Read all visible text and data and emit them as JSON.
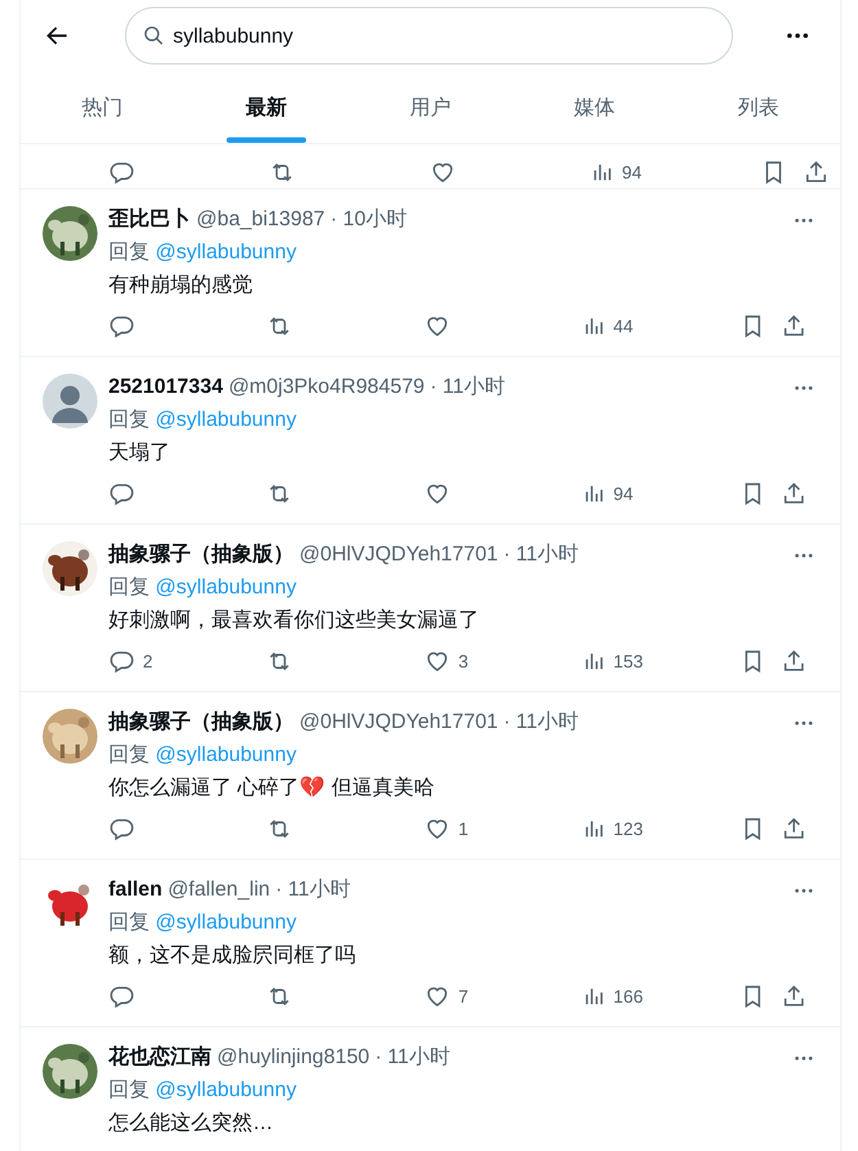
{
  "search": {
    "value": "syllabubunny"
  },
  "tabs": [
    {
      "label": "热门",
      "selected": false
    },
    {
      "label": "最新",
      "selected": true
    },
    {
      "label": "用户",
      "selected": false
    },
    {
      "label": "媒体",
      "selected": false
    },
    {
      "label": "列表",
      "selected": false
    }
  ],
  "partial_actions": {
    "views": "94"
  },
  "tweets": [
    {
      "name": "歪比巴卜",
      "handle": "@ba_bi13987",
      "time": "· 10小时",
      "reply_label": "回复",
      "reply_to": "@syllabubunny",
      "text": "有种崩塌的感觉",
      "actions": {
        "views": "44"
      }
    },
    {
      "avatar": {
        "kind": "default"
      },
      "name": "2521017334",
      "handle": "@m0j3Pko4R984579",
      "time": "· 11小时",
      "reply_label": "回复",
      "reply_to": "@syllabubunny",
      "text": "天塌了",
      "actions": {
        "views": "94"
      }
    },
    {
      "name": "抽象骡子（抽象版）",
      "handle": "@0HlVJQDYeh17701",
      "time": "· 11小时",
      "reply_label": "回复",
      "reply_to": "@syllabubunny",
      "text": "好刺激啊，最喜欢看你们这些美女漏逼了",
      "actions": {
        "replies": "2",
        "likes": "3",
        "views": "153"
      }
    },
    {
      "name": "抽象骡子（抽象版）",
      "handle": "@0HlVJQDYeh17701",
      "time": "· 11小时",
      "reply_label": "回复",
      "reply_to": "@syllabubunny",
      "text": "你怎么漏逼了 心碎了💔 但逼真美哈",
      "actions": {
        "likes": "1",
        "views": "123"
      }
    },
    {
      "name": "fallen",
      "handle": "@fallen_lin",
      "time": "· 11小时",
      "reply_label": "回复",
      "reply_to": "@syllabubunny",
      "text": "额，这不是成脸屄同框了吗",
      "actions": {
        "likes": "7",
        "views": "166"
      }
    },
    {
      "name": "花也恋江南",
      "handle": "@huylinjing8150",
      "time": "· 11小时",
      "reply_label": "回复",
      "reply_to": "@syllabubunny",
      "text": "怎么能这么突然…"
    }
  ]
}
